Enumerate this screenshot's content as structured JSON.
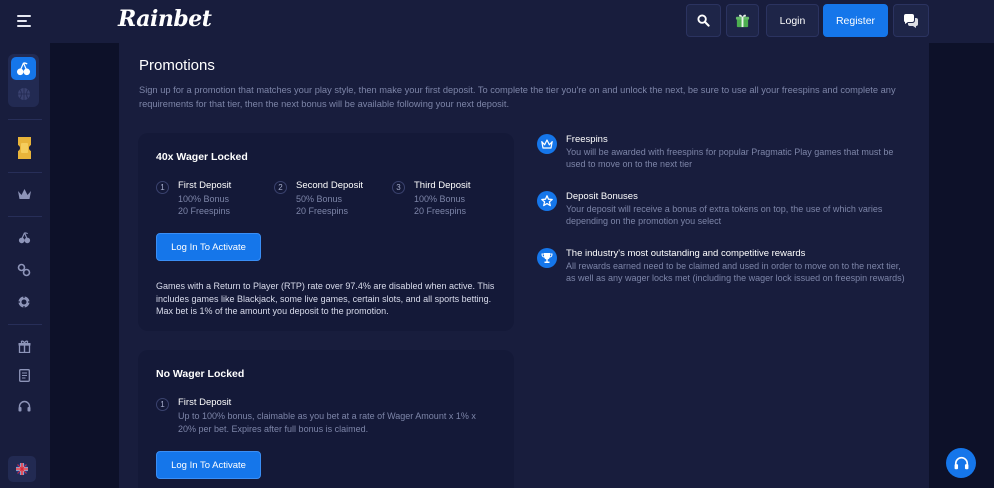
{
  "header": {
    "logo": "Rainbet",
    "login_label": "Login",
    "register_label": "Register",
    "icons": [
      "menu-icon",
      "search-icon",
      "gift-icon",
      "chat-icon"
    ]
  },
  "sidebar": {
    "icons": [
      "cherries-icon",
      "basketball-icon",
      "ticket-icon",
      "crown-icon",
      "cherries-icon",
      "infinity-icon",
      "chip-icon",
      "gift-icon",
      "document-icon",
      "headset-icon",
      "uk-flag-icon"
    ]
  },
  "page": {
    "title": "Promotions",
    "intro": "Sign up for a promotion that matches your play style, then make your first deposit. To complete the tier you're on and unlock the next, be sure to use all your freespins and complete any requirements for that tier, then the next bonus will be available following your next deposit."
  },
  "cards": [
    {
      "title": "40x Wager Locked",
      "steps": [
        {
          "num": "1",
          "title": "First Deposit",
          "line1": "100% Bonus",
          "line2": "20 Freespins"
        },
        {
          "num": "2",
          "title": "Second Deposit",
          "line1": "50% Bonus",
          "line2": "20 Freespins"
        },
        {
          "num": "3",
          "title": "Third Deposit",
          "line1": "100% Bonus",
          "line2": "20 Freespins"
        }
      ],
      "cta": "Log In To Activate",
      "note": "Games with a Return to Player (RTP) rate over 97.4% are disabled when active. This includes games like Blackjack, some live games, certain slots, and all sports betting. Max bet is 1% of the amount you deposit to the promotion."
    },
    {
      "title": "No Wager Locked",
      "steps": [
        {
          "num": "1",
          "title": "First Deposit",
          "desc": "Up to 100% bonus, claimable as you bet at a rate of Wager Amount x 1% x 20% per bet. Expires after full bonus is claimed."
        }
      ],
      "cta": "Log In To Activate"
    }
  ],
  "features": [
    {
      "icon": "crown-icon",
      "title": "Freespins",
      "desc": "You will be awarded with freespins for popular Pragmatic Play games that must be used to move on to the next tier"
    },
    {
      "icon": "star-icon",
      "title": "Deposit Bonuses",
      "desc": "Your deposit will receive a bonus of extra tokens on top, the use of which varies depending on the promotion you select"
    },
    {
      "icon": "trophy-icon",
      "title": "The industry's most outstanding and competitive rewards",
      "desc": "All rewards earned need to be claimed and used in order to move on to the next tier, as well as any wager locks met (including the wager lock issued on freespin rewards)"
    }
  ],
  "colors": {
    "accent": "#1576ea",
    "background": "#0d1129",
    "panel": "#181d3d",
    "card": "#141938",
    "muted_text": "#7d85a8"
  }
}
